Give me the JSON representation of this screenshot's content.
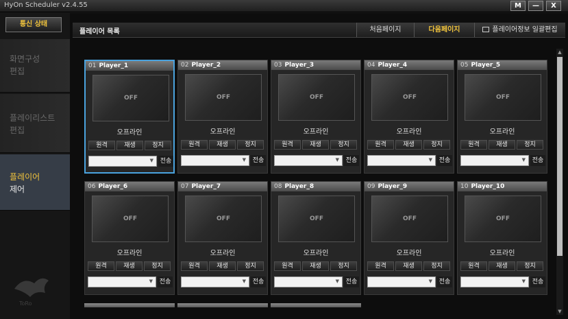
{
  "window": {
    "title": "HyOn Scheduler v2.4.55",
    "buttons": [
      "M",
      "—",
      "X"
    ]
  },
  "sidebar": {
    "status_button": "통신 상태",
    "items": [
      {
        "line1": "화면구성",
        "line2": "편집",
        "active": false
      },
      {
        "line1": "플레이리스트",
        "line2": "편집",
        "active": false
      },
      {
        "line1": "플레이어",
        "line2": "제어",
        "active": true
      }
    ]
  },
  "header": {
    "title": "플레이어 목록",
    "first_page": "처음페이지",
    "next_page": "다음페이지",
    "bulk_edit": "플레이어정보 일괄편집"
  },
  "players": [
    {
      "num": "01",
      "name": "Player_1",
      "screen": "OFF",
      "status": "오프라인",
      "selected": true
    },
    {
      "num": "02",
      "name": "Player_2",
      "screen": "OFF",
      "status": "오프라인",
      "selected": false
    },
    {
      "num": "03",
      "name": "Player_3",
      "screen": "OFF",
      "status": "오프라인",
      "selected": false
    },
    {
      "num": "04",
      "name": "Player_4",
      "screen": "OFF",
      "status": "오프라인",
      "selected": false
    },
    {
      "num": "05",
      "name": "Player_5",
      "screen": "OFF",
      "status": "오프라인",
      "selected": false
    },
    {
      "num": "06",
      "name": "Player_6",
      "screen": "OFF",
      "status": "오프라인",
      "selected": false
    },
    {
      "num": "07",
      "name": "Player_7",
      "screen": "OFF",
      "status": "오프라인",
      "selected": false
    },
    {
      "num": "08",
      "name": "Player_8",
      "screen": "OFF",
      "status": "오프라인",
      "selected": false
    },
    {
      "num": "09",
      "name": "Player_9",
      "screen": "OFF",
      "status": "오프라인",
      "selected": false
    },
    {
      "num": "10",
      "name": "Player_10",
      "screen": "OFF",
      "status": "오프라인",
      "selected": false
    }
  ],
  "card_labels": {
    "remote": "원격",
    "play": "재생",
    "stop": "정지",
    "send": "전송"
  },
  "colors": {
    "accent_yellow": "#f0c33c",
    "selected_border": "#4aa3df"
  }
}
